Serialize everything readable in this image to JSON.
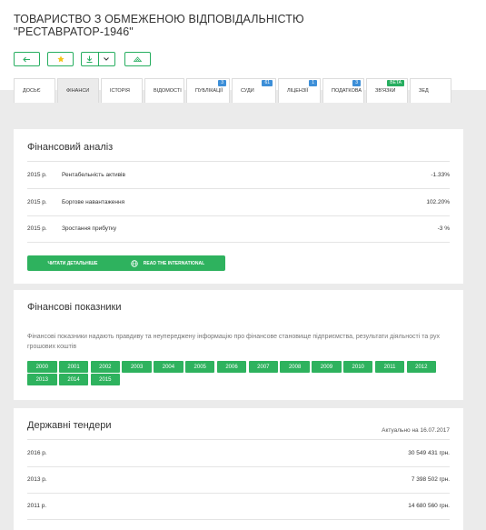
{
  "company": {
    "name_line1": "ТОВАРИСТВО З ОБМЕЖЕНОЮ ВІДПОВІДАЛЬНІСТЮ",
    "name_line2": "\"РЕСТАВРАТОР-1946\""
  },
  "tabs": [
    {
      "label": "Досьє",
      "badge": ""
    },
    {
      "label": "Фінанси",
      "badge": ""
    },
    {
      "label": "Історія",
      "badge": ""
    },
    {
      "label": "Відомості",
      "badge": ""
    },
    {
      "label": "Публікації",
      "badge": "3"
    },
    {
      "label": "Суди",
      "badge": "61"
    },
    {
      "label": "Ліцензії",
      "badge": "1"
    },
    {
      "label": "Податкова",
      "badge": "3"
    },
    {
      "label": "Зв'язки",
      "badge": "beta"
    },
    {
      "label": "ЗЕД",
      "badge": ""
    }
  ],
  "financial_analysis": {
    "title": "Фінансовий аналіз",
    "rows": [
      {
        "year": "2015 р.",
        "label": "Рентабельність активів",
        "value": "-1.33%"
      },
      {
        "year": "2015 р.",
        "label": "Боргове навантаження",
        "value": "102.20%"
      },
      {
        "year": "2015 р.",
        "label": "Зростання прибутку",
        "value": "-3 %"
      }
    ],
    "read_more": "Читати детальніше",
    "read_international": "Read the international"
  },
  "indicators": {
    "title": "Фінансові показники",
    "description": "Фінансові показники надають правдиву та неупереджену інформацію про фінансове становище підприємства, результати діяльності та рух грошових коштів",
    "years": [
      "2000",
      "2001",
      "2002",
      "2003",
      "2004",
      "2005",
      "2006",
      "2007",
      "2008",
      "2009",
      "2010",
      "2011",
      "2012",
      "2013",
      "2014",
      "2015"
    ]
  },
  "tenders": {
    "title": "Державні тендери",
    "actual": "Актуально на 16.07.2017",
    "rows": [
      {
        "year": "2016 р.",
        "value": "30 549 431 грн."
      },
      {
        "year": "2013 р.",
        "value": "7 398 502 грн."
      },
      {
        "year": "2011 р.",
        "value": "14 680 560 грн."
      }
    ]
  },
  "icons": {
    "back": "arrow-left-icon",
    "favorite": "star-icon",
    "download": "download-icon",
    "dropdown": "chevron-down-icon",
    "monitor": "mountain-icon",
    "globe": "globe-icon"
  },
  "colors": {
    "accent": "#2eb25e",
    "star": "#f5c518",
    "badge_blue": "#3d8fd8"
  }
}
